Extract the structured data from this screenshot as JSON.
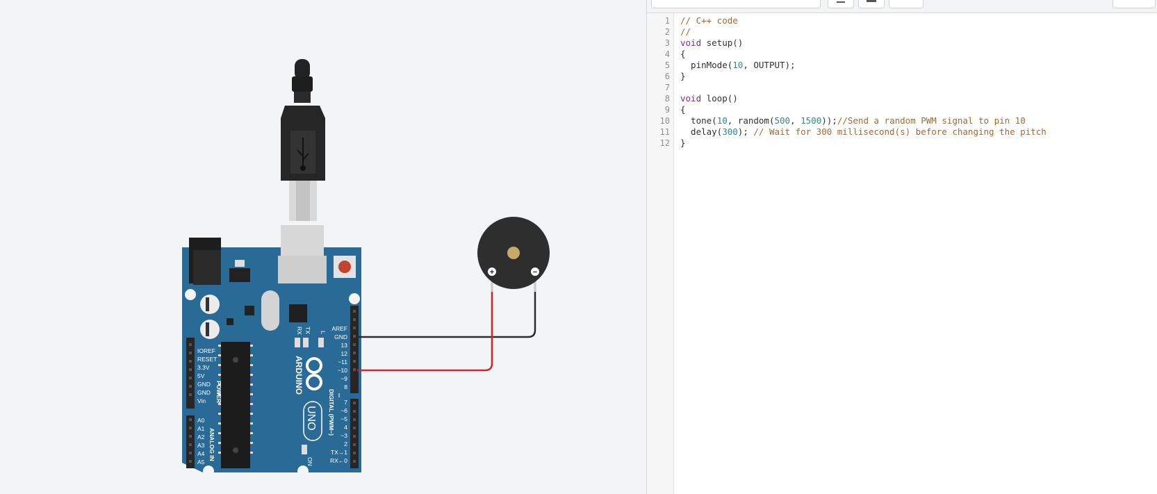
{
  "colors": {
    "board": "#2a6a97",
    "wire_red": "#d0262b",
    "wire_black": "#2b2b2b",
    "buzzer": "#2e2e2e",
    "comment": "#a46a2a",
    "keyword": "#7a2d8c",
    "number": "#2b8a8a"
  },
  "board": {
    "brand": "ARDUINO",
    "model": "UNO",
    "on_label": "ON",
    "tx_label": "TX",
    "rx_label": "RX",
    "l_label": "L",
    "power_header": "POWER",
    "analog_header": "ANALOG IN",
    "digital_header": "DIGITAL (PWM~)",
    "power_pins": [
      "IOREF",
      "RESET",
      "3.3V",
      "5V",
      "GND",
      "GND",
      "Vin"
    ],
    "analog_pins": [
      "A0",
      "A1",
      "A2",
      "A3",
      "A4",
      "A5"
    ],
    "digital_pins_top": [
      "AREF",
      "GND",
      "13",
      "12",
      "~11",
      "~10",
      "~9",
      "8"
    ],
    "digital_pins_bottom": [
      "7",
      "~6",
      "~5",
      "4",
      "~3",
      "2",
      "TX→1",
      "RX←0"
    ]
  },
  "buzzer": {
    "plus": "+",
    "minus": "−"
  },
  "editor": {
    "line_numbers": [
      "1",
      "2",
      "3",
      "4",
      "5",
      "6",
      "7",
      "8",
      "9",
      "10",
      "11",
      "12"
    ],
    "line1": "// C++ code",
    "line2": "//",
    "line3": {
      "kw": "void",
      "rest": " setup()"
    },
    "line4": "{",
    "line5": {
      "a": "  pinMode(",
      "n": "10",
      "b": ", OUTPUT);"
    },
    "line6": "}",
    "line7": "",
    "line8": {
      "kw": "void",
      "rest": " loop()"
    },
    "line9": "{",
    "line10": {
      "a": "  tone(",
      "n1": "10",
      "b": ", random(",
      "n2": "500",
      "c": ", ",
      "n3": "1500",
      "d": "));",
      "comment": "//Send a random PWM signal to pin 10"
    },
    "line11": {
      "a": "  delay(",
      "n": "300",
      "b": "); ",
      "comment": "// Wait for 300 millisecond(s) before changing the pitch"
    },
    "line12": "}"
  }
}
